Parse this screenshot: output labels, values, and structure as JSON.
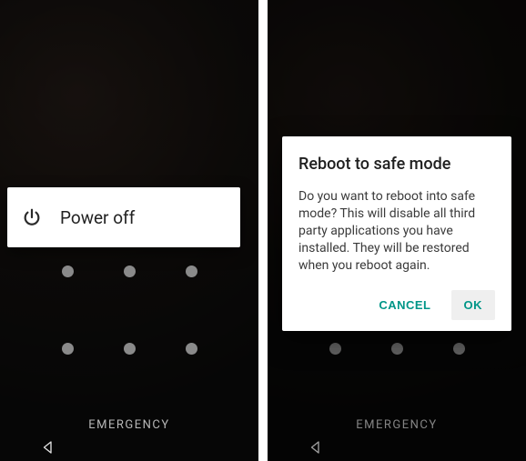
{
  "colors": {
    "accent": "#009688",
    "dialog_bg": "#ffffff",
    "dot": "#8a8a8a"
  },
  "left": {
    "power_off_label": "Power off",
    "emergency_label": "EMERGENCY"
  },
  "right": {
    "dialog": {
      "title": "Reboot to safe mode",
      "body": "Do you want to reboot into safe mode? This will disable all third party applications you have installed. They will be restored when you reboot again.",
      "cancel_label": "CANCEL",
      "ok_label": "OK"
    },
    "emergency_label": "EMERGENCY"
  }
}
